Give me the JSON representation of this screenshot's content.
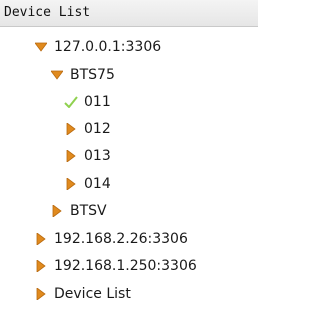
{
  "panel": {
    "title": "Device List"
  },
  "tree": [
    {
      "label": "127.0.0.1:3306",
      "expanded": true,
      "icon": "triangle-expanded-icon"
    },
    {
      "label": "BTS75",
      "expanded": true,
      "icon": "triangle-expanded-icon"
    },
    {
      "label": "011",
      "icon": "checkmark-icon"
    },
    {
      "label": "012",
      "icon": "triangle-collapsed-icon"
    },
    {
      "label": "013",
      "icon": "triangle-collapsed-icon"
    },
    {
      "label": "014",
      "icon": "triangle-collapsed-icon"
    },
    {
      "label": "BTSV",
      "icon": "triangle-collapsed-icon"
    },
    {
      "label": "192.168.2.26:3306",
      "icon": "triangle-collapsed-icon"
    },
    {
      "label": "192.168.1.250:3306",
      "icon": "triangle-collapsed-icon"
    },
    {
      "label": "Device List",
      "icon": "triangle-collapsed-icon"
    }
  ],
  "colors": {
    "triangle": "#e08a1e",
    "check": "#8fd14f"
  }
}
